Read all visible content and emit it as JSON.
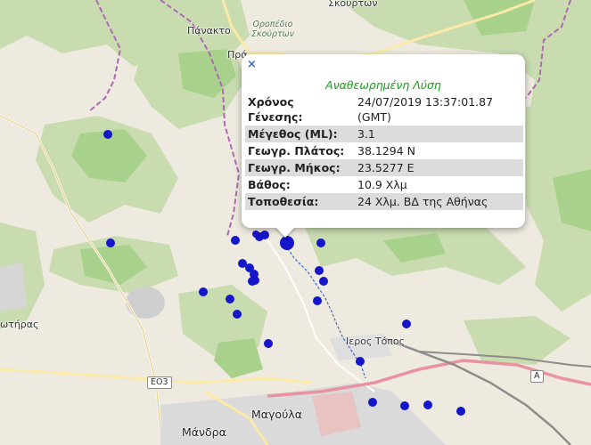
{
  "map": {
    "places": {
      "skourton_top": "Σκούρτων",
      "panakto": "Πάνακτο",
      "oropedio_l1": "Οροπέδιο",
      "oropedio_l2": "Σκούρτων",
      "pra": "Πρά",
      "sotiras": "ωτήρας",
      "ieros_topos": "Ιερος Τόπος",
      "magoula": "Μαγούλα",
      "mandra": "Μάνδρα"
    },
    "road_shields": {
      "e03": "ΕΟ3",
      "a6": "Α"
    },
    "colors": {
      "marker": "#1515c9",
      "forest": "#c8dcb0",
      "green_area": "#a8d28c",
      "border": "#ad6ab2",
      "river": "#3c6fc8",
      "motorway": "#e892a2",
      "railway": "#8c8c8c"
    },
    "marker_count": 26
  },
  "popup": {
    "close_symbol": "×",
    "title": "Αναθεωρημένη Λύση",
    "rows": [
      {
        "label": "Χρόνος Γένεσης:",
        "value": "24/07/2019 13:37:01.87 (GMT)"
      },
      {
        "label": "Μέγεθος (ML):",
        "value": "3.1"
      },
      {
        "label": "Γεωγρ. Πλάτος:",
        "value": "38.1294 N"
      },
      {
        "label": "Γεωγρ. Μήκος:",
        "value": "23.5277 E"
      },
      {
        "label": "Βάθος:",
        "value": "10.9 Χλμ"
      },
      {
        "label": "Τοποθεσία:",
        "value": "24 Χλμ. ΒΔ της Αθήνας"
      }
    ]
  }
}
